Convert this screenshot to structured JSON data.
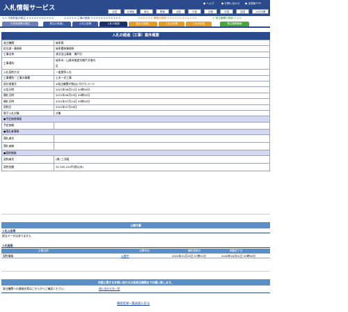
{
  "header": {
    "logo": "入札情報サービス",
    "links": [
      "● ヘルプ",
      "● お問い合わせ",
      "● 全国版TOP"
    ],
    "regions": [
      "全国",
      "北海道",
      "東北",
      "関東",
      "北陸",
      "中部",
      "近畿",
      "中国",
      "四国",
      "九州沖縄"
    ]
  },
  "categories": [
    "中央府省の発注",
    "工事の検索",
    "業務の検索",
    "発注機関の検索"
  ],
  "tabs": [
    "中央府省等の発注",
    "発注の見通し",
    "入札公告等",
    "入札の経過",
    "発注の見通し",
    "入札公告等",
    "入札の経過",
    "発注機関情報"
  ],
  "detail": {
    "title": "入札の経過（工事）案件概要",
    "rows": [
      {
        "label": "発注機関",
        "value": "岐阜県"
      },
      {
        "label": "担当部・事務所",
        "value": "岐阜農林事務所"
      },
      {
        "label": "工事名称",
        "value": "漆沼治山事業　樽戸沢"
      },
      {
        "label": "工事場所",
        "value": "岐阜市・山県市椎倉字樽戸沢地内",
        "value2": "区"
      },
      {
        "label": "入札契約方式",
        "value": "一般競争入札"
      },
      {
        "label": "工事種別／工事の業種",
        "value": "土木一式工事"
      },
      {
        "label": "設計書番号",
        "value": "※発注機関が独自に付けたコード"
      },
      {
        "label": "公告日時",
        "value": "2021年06月21日 00時00分"
      },
      {
        "label": "開札日時",
        "value": "2021年06月29日 09時00分"
      },
      {
        "label": "開札日時",
        "value": "2021年07月14日 09時00分"
      },
      {
        "label": "契約日",
        "value": "2021年07月26日"
      },
      {
        "label": "電子入札対象",
        "value": "対象"
      }
    ],
    "sec_estimate": "●予定価格情報",
    "estimate_label": "予定価格",
    "sec_winner": "●落札者情報",
    "winner_name_label": "落札者名",
    "winner_price_label": "落札価格",
    "sec_contract": "●契約情報",
    "contractor_label": "契約者名",
    "contractor_value": "(株) 三洋組",
    "amount_label": "契約金額",
    "amount_value": "32,165,100円(税込み)"
  },
  "public_docs": {
    "title": "公開文書",
    "notice_heading": "入札公告等",
    "notice_empty": "該当データはありません",
    "progress_heading": "入札経過",
    "cols": [
      "文書名称",
      "公開状況",
      "最終更新日",
      "掲載終了日"
    ],
    "row": {
      "name": "契約情報",
      "status": "公開中",
      "updated": "2022年01月25日 07時01分",
      "end": "2026年04月01日 00時00分"
    }
  },
  "inquiry": {
    "banner": "内容に関するお問い合わせは各発注機関までお願い致します。",
    "text": "発注機関への連絡先等はこちらからご確認ください。",
    "link": "問い合わせ先一覧"
  },
  "footer_link": "検索結果一覧画面に戻る",
  "colors": {
    "navy": "#2a4a8c",
    "section": "#d5d8f2",
    "bar": "#5b8fc8"
  }
}
